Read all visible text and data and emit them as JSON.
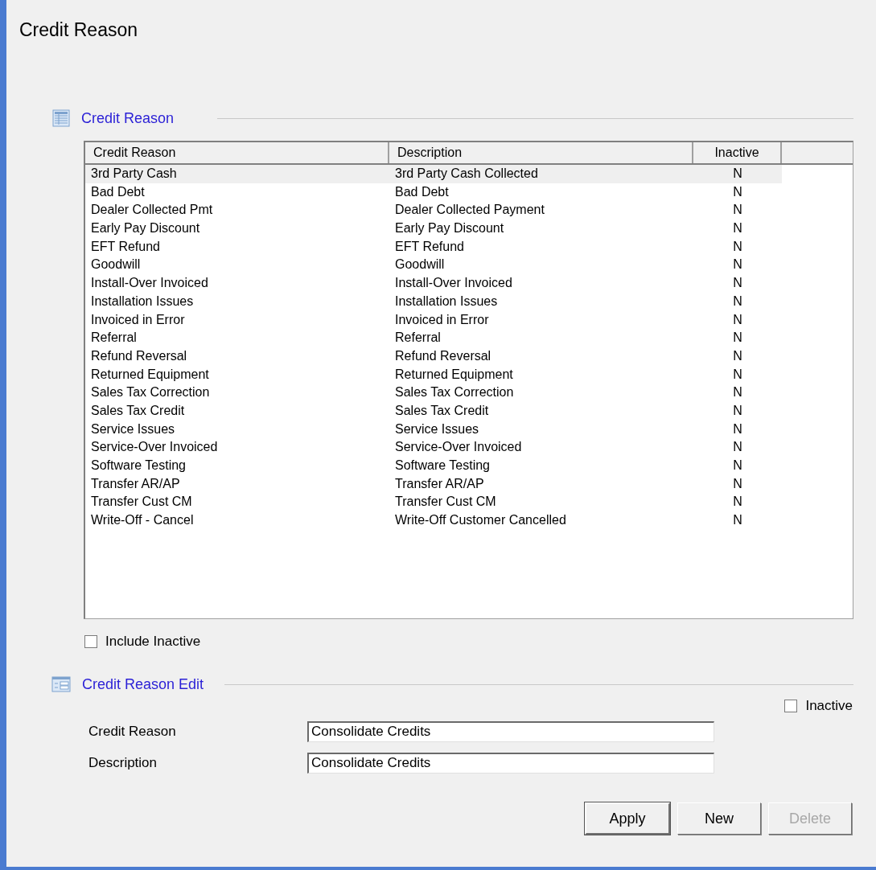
{
  "window": {
    "title": "Credit Reason"
  },
  "list_section": {
    "title": "Credit Reason"
  },
  "table": {
    "columns": [
      "Credit Reason",
      "Description",
      "Inactive"
    ],
    "rows": [
      {
        "cells": [
          "3rd Party Cash",
          "3rd Party Cash Collected",
          "N"
        ],
        "selected": true
      },
      {
        "cells": [
          "Bad Debt",
          "Bad Debt",
          "N"
        ],
        "selected": false
      },
      {
        "cells": [
          "Dealer Collected Pmt",
          "Dealer Collected Payment",
          "N"
        ],
        "selected": false
      },
      {
        "cells": [
          "Early Pay Discount",
          "Early Pay Discount",
          "N"
        ],
        "selected": false
      },
      {
        "cells": [
          "EFT Refund",
          "EFT Refund",
          "N"
        ],
        "selected": false
      },
      {
        "cells": [
          "Goodwill",
          "Goodwill",
          "N"
        ],
        "selected": false
      },
      {
        "cells": [
          "Install-Over Invoiced",
          "Install-Over Invoiced",
          "N"
        ],
        "selected": false
      },
      {
        "cells": [
          "Installation Issues",
          "Installation Issues",
          "N"
        ],
        "selected": false
      },
      {
        "cells": [
          "Invoiced in Error",
          "Invoiced in Error",
          "N"
        ],
        "selected": false
      },
      {
        "cells": [
          "Referral",
          "Referral",
          "N"
        ],
        "selected": false
      },
      {
        "cells": [
          "Refund Reversal",
          "Refund Reversal",
          "N"
        ],
        "selected": false
      },
      {
        "cells": [
          "Returned Equipment",
          "Returned Equipment",
          "N"
        ],
        "selected": false
      },
      {
        "cells": [
          "Sales Tax Correction",
          "Sales Tax Correction",
          "N"
        ],
        "selected": false
      },
      {
        "cells": [
          "Sales Tax Credit",
          "Sales Tax Credit",
          "N"
        ],
        "selected": false
      },
      {
        "cells": [
          "Service Issues",
          "Service Issues",
          "N"
        ],
        "selected": false
      },
      {
        "cells": [
          "Service-Over Invoiced",
          "Service-Over Invoiced",
          "N"
        ],
        "selected": false
      },
      {
        "cells": [
          "Software Testing",
          "Software Testing",
          "N"
        ],
        "selected": false
      },
      {
        "cells": [
          "Transfer AR/AP",
          "Transfer AR/AP",
          "N"
        ],
        "selected": false
      },
      {
        "cells": [
          "Transfer Cust CM",
          "Transfer Cust CM",
          "N"
        ],
        "selected": false
      },
      {
        "cells": [
          "Write-Off - Cancel",
          "Write-Off Customer Cancelled",
          "N"
        ],
        "selected": false
      }
    ]
  },
  "include_inactive": {
    "label": "Include Inactive",
    "checked": false
  },
  "edit_section": {
    "title": "Credit Reason Edit"
  },
  "inactive": {
    "label": "Inactive",
    "checked": false
  },
  "fields": [
    {
      "label": "Credit Reason",
      "value": "Consolidate Credits"
    },
    {
      "label": "Description",
      "value": "Consolidate Credits"
    }
  ],
  "buttons": [
    {
      "label": "Apply",
      "disabled": false
    },
    {
      "label": "New",
      "disabled": false
    },
    {
      "label": "Delete",
      "disabled": true
    }
  ]
}
